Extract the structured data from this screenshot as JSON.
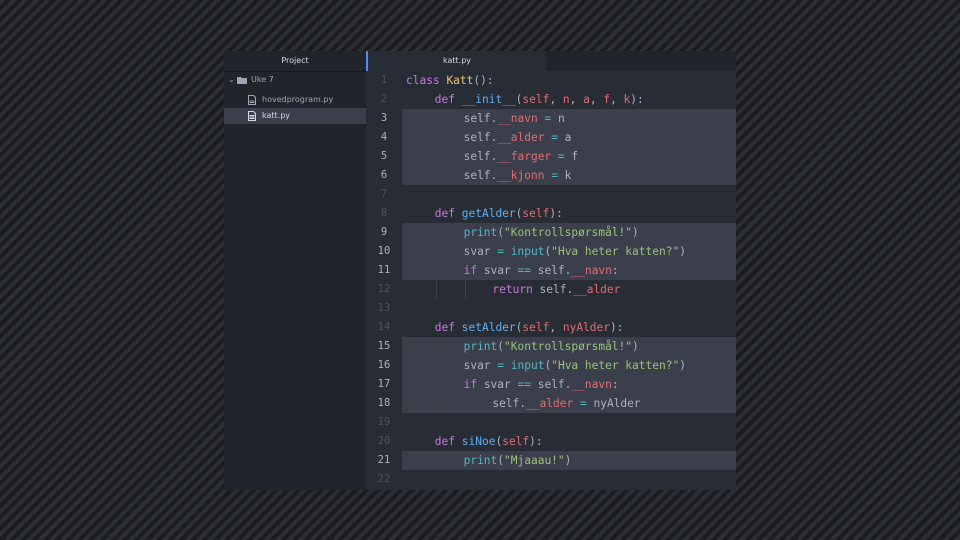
{
  "sidebar": {
    "header": "Project",
    "folder": "Uke 7",
    "files": [
      {
        "name": "hovedprogram.py",
        "selected": false
      },
      {
        "name": "katt.py",
        "selected": true
      }
    ]
  },
  "tab": {
    "label": "katt.py"
  },
  "editor": {
    "lines": [
      {
        "n": "1",
        "indent": 0,
        "hl": false,
        "tokens": [
          [
            "kw",
            "class"
          ],
          [
            "pl",
            " "
          ],
          [
            "cls",
            "Katt"
          ],
          [
            "pl",
            "():"
          ]
        ]
      },
      {
        "n": "2",
        "indent": 1,
        "hl": false,
        "tokens": [
          [
            "kw",
            "def"
          ],
          [
            "pl",
            " "
          ],
          [
            "mg",
            "__init__"
          ],
          [
            "pl",
            "("
          ],
          [
            "prm",
            "self"
          ],
          [
            "pl",
            ", "
          ],
          [
            "prm",
            "n"
          ],
          [
            "pl",
            ", "
          ],
          [
            "prm",
            "a"
          ],
          [
            "pl",
            ", "
          ],
          [
            "prm",
            "f"
          ],
          [
            "pl",
            ", "
          ],
          [
            "prm",
            "k"
          ],
          [
            "pl",
            "):"
          ]
        ]
      },
      {
        "n": "3",
        "indent": 2,
        "hl": true,
        "tokens": [
          [
            "pl",
            "self."
          ],
          [
            "prop",
            "__navn"
          ],
          [
            "pl",
            " "
          ],
          [
            "op",
            "="
          ],
          [
            "pl",
            " n"
          ]
        ]
      },
      {
        "n": "4",
        "indent": 2,
        "hl": true,
        "tokens": [
          [
            "pl",
            "self."
          ],
          [
            "prop",
            "__alder"
          ],
          [
            "pl",
            " "
          ],
          [
            "op",
            "="
          ],
          [
            "pl",
            " a"
          ]
        ]
      },
      {
        "n": "5",
        "indent": 2,
        "hl": true,
        "tokens": [
          [
            "pl",
            "self."
          ],
          [
            "prop",
            "__farger"
          ],
          [
            "pl",
            " "
          ],
          [
            "op",
            "="
          ],
          [
            "pl",
            " f"
          ]
        ]
      },
      {
        "n": "6",
        "indent": 2,
        "hl": true,
        "tokens": [
          [
            "pl",
            "self."
          ],
          [
            "prop",
            "__kjonn"
          ],
          [
            "pl",
            " "
          ],
          [
            "op",
            "="
          ],
          [
            "pl",
            " k"
          ]
        ]
      },
      {
        "n": "7",
        "indent": 0,
        "hl": false,
        "tokens": []
      },
      {
        "n": "8",
        "indent": 1,
        "hl": false,
        "tokens": [
          [
            "kw",
            "def"
          ],
          [
            "pl",
            " "
          ],
          [
            "fn",
            "getAlder"
          ],
          [
            "pl",
            "("
          ],
          [
            "prm",
            "self"
          ],
          [
            "pl",
            "):"
          ]
        ]
      },
      {
        "n": "9",
        "indent": 2,
        "hl": true,
        "tokens": [
          [
            "bi",
            "print"
          ],
          [
            "pl",
            "("
          ],
          [
            "str",
            "\"Kontrollspørsmål!\""
          ],
          [
            "pl",
            ")"
          ]
        ]
      },
      {
        "n": "10",
        "indent": 2,
        "hl": true,
        "tokens": [
          [
            "pl",
            "svar "
          ],
          [
            "op",
            "="
          ],
          [
            "pl",
            " "
          ],
          [
            "bi",
            "input"
          ],
          [
            "pl",
            "("
          ],
          [
            "str",
            "\"Hva heter katten?\""
          ],
          [
            "pl",
            ")"
          ]
        ]
      },
      {
        "n": "11",
        "indent": 2,
        "hl": true,
        "tokens": [
          [
            "kw",
            "if"
          ],
          [
            "pl",
            " svar "
          ],
          [
            "op",
            "=="
          ],
          [
            "pl",
            " self."
          ],
          [
            "prop",
            "__navn"
          ],
          [
            "pl",
            ":"
          ]
        ]
      },
      {
        "n": "12",
        "indent": 3,
        "hl": false,
        "tokens": [
          [
            "kw",
            "return"
          ],
          [
            "pl",
            " self."
          ],
          [
            "prop",
            "__alder"
          ]
        ]
      },
      {
        "n": "13",
        "indent": 0,
        "hl": false,
        "tokens": []
      },
      {
        "n": "14",
        "indent": 1,
        "hl": false,
        "tokens": [
          [
            "kw",
            "def"
          ],
          [
            "pl",
            " "
          ],
          [
            "fn",
            "setAlder"
          ],
          [
            "pl",
            "("
          ],
          [
            "prm",
            "self"
          ],
          [
            "pl",
            ", "
          ],
          [
            "prm",
            "nyAlder"
          ],
          [
            "pl",
            "):"
          ]
        ]
      },
      {
        "n": "15",
        "indent": 2,
        "hl": true,
        "tokens": [
          [
            "bi",
            "print"
          ],
          [
            "pl",
            "("
          ],
          [
            "str",
            "\"Kontrollspørsmål!\""
          ],
          [
            "pl",
            ")"
          ]
        ]
      },
      {
        "n": "16",
        "indent": 2,
        "hl": true,
        "tokens": [
          [
            "pl",
            "svar "
          ],
          [
            "op",
            "="
          ],
          [
            "pl",
            " "
          ],
          [
            "bi",
            "input"
          ],
          [
            "pl",
            "("
          ],
          [
            "str",
            "\"Hva heter katten?\""
          ],
          [
            "pl",
            ")"
          ]
        ]
      },
      {
        "n": "17",
        "indent": 2,
        "hl": true,
        "tokens": [
          [
            "kw",
            "if"
          ],
          [
            "pl",
            " svar "
          ],
          [
            "op",
            "=="
          ],
          [
            "pl",
            " self."
          ],
          [
            "prop",
            "__navn"
          ],
          [
            "pl",
            ":"
          ]
        ]
      },
      {
        "n": "18",
        "indent": 3,
        "hl": true,
        "tokens": [
          [
            "pl",
            "self."
          ],
          [
            "prop",
            "__alder"
          ],
          [
            "pl",
            " "
          ],
          [
            "op",
            "="
          ],
          [
            "pl",
            " nyAlder"
          ]
        ]
      },
      {
        "n": "19",
        "indent": 0,
        "hl": false,
        "tokens": []
      },
      {
        "n": "20",
        "indent": 1,
        "hl": false,
        "tokens": [
          [
            "kw",
            "def"
          ],
          [
            "pl",
            " "
          ],
          [
            "fn",
            "siNoe"
          ],
          [
            "pl",
            "("
          ],
          [
            "prm",
            "self"
          ],
          [
            "pl",
            "):"
          ]
        ]
      },
      {
        "n": "21",
        "indent": 2,
        "hl": true,
        "tokens": [
          [
            "bi",
            "print"
          ],
          [
            "pl",
            "("
          ],
          [
            "str",
            "\"Mjaaau!\""
          ],
          [
            "pl",
            ")"
          ]
        ]
      },
      {
        "n": "22",
        "indent": 0,
        "hl": false,
        "tokens": []
      }
    ]
  }
}
